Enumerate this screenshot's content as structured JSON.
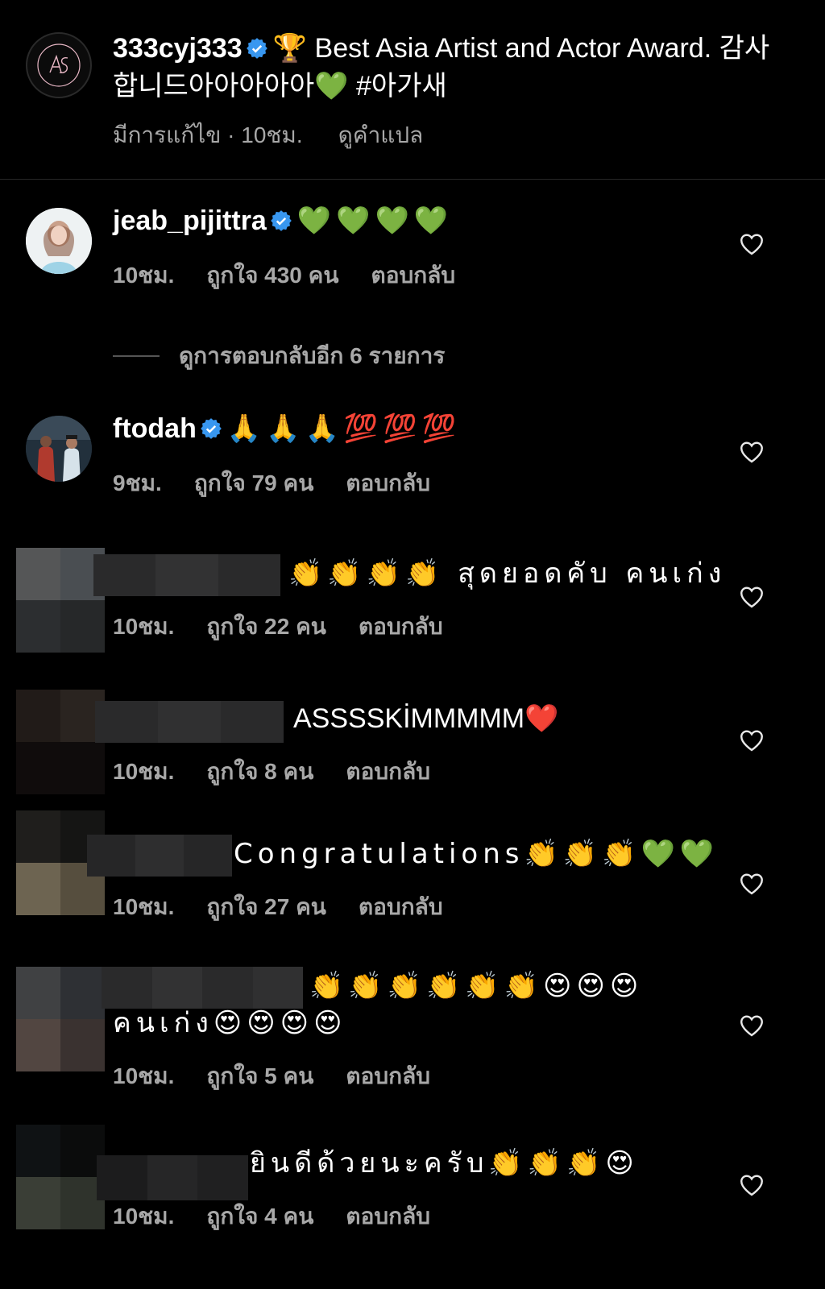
{
  "caption": {
    "username": "333cyj333",
    "text": "🏆 Best Asia Artist and Actor Award. 감사합니드아아아아아💚 #아가새",
    "edited": "มีการแก้ไข · 10ชม.",
    "translate": "ดูคำแปล"
  },
  "comments": [
    {
      "username": "jeab_pijittra",
      "verified": true,
      "text": "💚💚💚💚",
      "time": "10ชม.",
      "likes": "ถูกใจ 430 คน",
      "reply": "ตอบกลับ"
    },
    {
      "username": "ftodah",
      "verified": true,
      "text": "🙏🙏🙏💯💯💯",
      "time": "9ชม.",
      "likes": "ถูกใจ 79 คน",
      "reply": "ตอบกลับ"
    },
    {
      "username": "",
      "text": "👏👏👏👏 สุดยอดคับ คนเก่ง",
      "time": "10ชม.",
      "likes": "ถูกใจ 22 คน",
      "reply": "ตอบกลับ"
    },
    {
      "username": "",
      "text": "ASSSSKİMMMMM❤️",
      "time": "10ชม.",
      "likes": "ถูกใจ 8 คน",
      "reply": "ตอบกลับ"
    },
    {
      "username": "",
      "text": "Congratulations👏👏👏💚💚",
      "time": "10ชม.",
      "likes": "ถูกใจ 27 คน",
      "reply": "ตอบกลับ"
    },
    {
      "username": "",
      "text": "👏👏👏👏👏👏😍😍😍",
      "text2": "คนเก่ง😍😍😍😍",
      "time": "10ชม.",
      "likes": "ถูกใจ 5 คน",
      "reply": "ตอบกลับ"
    },
    {
      "username": "",
      "text": "ยินดีด้วยนะครับ👏👏👏😍",
      "time": "10ชม.",
      "likes": "ถูกใจ 4 คน",
      "reply": "ตอบกลับ"
    }
  ],
  "view_replies": "ดูการตอบกลับอีก 6 รายการ",
  "icons": {
    "verified": "verified-badge-icon",
    "like": "heart-outline-icon"
  },
  "colors": {
    "background": "#000000",
    "secondary_text": "#a8a8a8",
    "verified_blue": "#3897f0"
  }
}
